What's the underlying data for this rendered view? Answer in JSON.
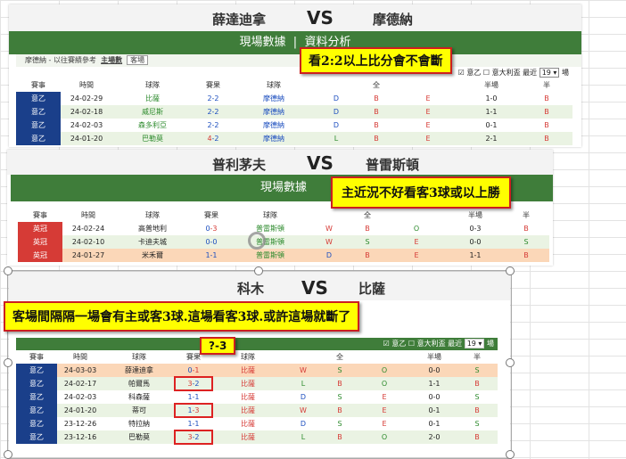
{
  "panel1": {
    "home": "薛達迪拿",
    "vs": "VS",
    "away": "摩德納",
    "banner": "現場數據",
    "banner_extra": "資料分析",
    "sub_text": "摩德納 - 以往賽績參考",
    "sub_tabs": [
      "主場數",
      "客場"
    ],
    "filter": {
      "league": "意乙",
      "neutral": "意大利盃",
      "recent_label": "最近",
      "recent_value": "19",
      "unit": "場"
    },
    "headers": [
      "賽事",
      "時間",
      "球隊",
      "賽果",
      "球隊",
      "",
      "全",
      "",
      "半場",
      "半"
    ],
    "rows": [
      {
        "league": "意乙",
        "date": "24-02-29",
        "opp": "比薩",
        "score": "2-2",
        "team": "摩德納",
        "wdl": "D",
        "a": "B",
        "b": "E",
        "half": "1-0",
        "c": "B"
      },
      {
        "league": "意乙",
        "date": "24-02-18",
        "opp": "威尼斯",
        "score": "2-2",
        "team": "摩德納",
        "wdl": "D",
        "a": "B",
        "b": "E",
        "half": "1-1",
        "c": "B"
      },
      {
        "league": "意乙",
        "date": "24-02-03",
        "opp": "森多利亞",
        "score": "2-2",
        "team": "摩德納",
        "wdl": "D",
        "a": "B",
        "b": "E",
        "half": "0-1",
        "c": "B"
      },
      {
        "league": "意乙",
        "date": "24-01-20",
        "opp": "巴勒莫",
        "score": "4-2",
        "team": "摩德納",
        "wdl": "L",
        "a": "B",
        "b": "E",
        "half": "2-1",
        "c": "B"
      }
    ]
  },
  "panel2": {
    "home": "普利茅夫",
    "vs": "VS",
    "away": "普雷斯頓",
    "banner": "現場數據",
    "headers": [
      "賽事",
      "時間",
      "球隊",
      "賽果",
      "球隊",
      "",
      "全",
      "",
      "半場",
      "半"
    ],
    "rows": [
      {
        "league": "英冠",
        "date": "24-02-24",
        "opp": "高普地利",
        "score": "0-3",
        "team": "普雷斯頓",
        "wdl": "W",
        "a": "B",
        "b": "O",
        "half": "0-3",
        "c": "B"
      },
      {
        "league": "英冠",
        "date": "24-02-10",
        "opp": "卡迪夫城",
        "score": "0-0",
        "team": "普雷斯頓",
        "wdl": "W",
        "a": "S",
        "b": "E",
        "half": "0-0",
        "c": "S"
      },
      {
        "league": "英冠",
        "date": "24-01-27",
        "opp": "米禾爾",
        "score": "1-1",
        "team": "普雷斯頓",
        "wdl": "D",
        "a": "B",
        "b": "E",
        "half": "1-1",
        "c": "B"
      }
    ]
  },
  "panel3": {
    "home": "科木",
    "vs": "VS",
    "away": "比薩",
    "score_tag": "?-3",
    "filter": {
      "league": "意乙",
      "neutral": "意大利盃",
      "recent_label": "最近",
      "recent_value": "19",
      "unit": "場"
    },
    "headers": [
      "賽事",
      "時間",
      "球隊",
      "賽果",
      "球隊",
      "",
      "全",
      "",
      "半場",
      "半"
    ],
    "rows": [
      {
        "league": "意乙",
        "date": "24-03-03",
        "opp": "薛達迪拿",
        "score": "0-1",
        "team": "比薩",
        "wdl": "W",
        "a": "S",
        "b": "O",
        "half": "0-0",
        "c": "S"
      },
      {
        "league": "意乙",
        "date": "24-02-17",
        "opp": "帕爾馬",
        "score": "3-2",
        "team": "比薩",
        "wdl": "L",
        "a": "B",
        "b": "O",
        "half": "1-1",
        "c": "B"
      },
      {
        "league": "意乙",
        "date": "24-02-03",
        "opp": "科森薩",
        "score": "1-1",
        "team": "比薩",
        "wdl": "D",
        "a": "S",
        "b": "E",
        "half": "0-0",
        "c": "S"
      },
      {
        "league": "意乙",
        "date": "24-01-20",
        "opp": "蒂可",
        "score": "1-3",
        "team": "比薩",
        "wdl": "W",
        "a": "B",
        "b": "E",
        "half": "0-1",
        "c": "B"
      },
      {
        "league": "意乙",
        "date": "23-12-26",
        "opp": "特拉納",
        "score": "1-1",
        "team": "比薩",
        "wdl": "D",
        "a": "S",
        "b": "E",
        "half": "0-1",
        "c": "S"
      },
      {
        "league": "意乙",
        "date": "23-12-16",
        "opp": "巴勒莫",
        "score": "3-2",
        "team": "比薩",
        "wdl": "L",
        "a": "B",
        "b": "O",
        "half": "2-0",
        "c": "B"
      }
    ]
  },
  "callouts": {
    "c1": "看2:2以上比分會不會斷",
    "c2": "主近況不好看客3球或以上勝",
    "c3": "客場間隔隔一場會有主或客3球.這場看客3球.或許這場就斷了"
  }
}
